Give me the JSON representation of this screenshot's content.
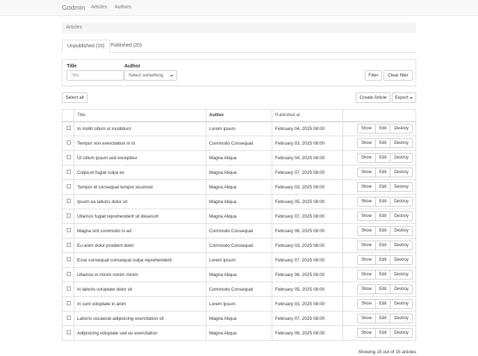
{
  "nav": {
    "brand": "Godmin",
    "links": [
      "Articles",
      "Authors"
    ]
  },
  "breadcrumb": "Articles",
  "tabs": [
    {
      "label": "Unpublished (15)",
      "active": true
    },
    {
      "label": "Published (20)",
      "active": false
    }
  ],
  "filter": {
    "title_label": "Title",
    "title_placeholder": "Title",
    "author_label": "Author",
    "author_select": "Select something",
    "filter_btn": "Filter",
    "clear_btn": "Clear filter"
  },
  "toolbar": {
    "select_all": "Select all",
    "create": "Create Article",
    "export": "Export"
  },
  "table": {
    "headers": [
      "Title",
      "Author",
      "Published at"
    ],
    "actions": [
      "Show",
      "Edit",
      "Destroy"
    ],
    "rows": [
      [
        "In mollit cillum ut incididunt",
        "Lorem Ipsum",
        "February 04, 2025 08:00"
      ],
      [
        "Tempor non exercitation in id",
        "Commodo Consequat",
        "February 03, 2025 08:00"
      ],
      [
        "Ut cillum ipsum sed excepteur",
        "Magna Aliqua",
        "February 04, 2025 08:00"
      ],
      [
        "Culpa et fugiat culpa ex",
        "Magna Aliqua",
        "February 07, 2025 08:00"
      ],
      [
        "Tempor id consequat tempor eiusmod",
        "Magna Aliqua",
        "February 03, 2025 08:00"
      ],
      [
        "Ipsum ea laboris dolor sit",
        "Magna Aliqua",
        "February 05, 2025 08:00"
      ],
      [
        "Ullamco fugiat reprehenderit sit deserunt",
        "Magna Aliqua",
        "February 07, 2025 08:00"
      ],
      [
        "Magna sint commodo in ad",
        "Commodo Consequat",
        "February 08, 2025 08:00"
      ],
      [
        "Eu anim dolor proident dolor",
        "Commodo Consequat",
        "February 03, 2025 08:00"
      ],
      [
        "Esse consequat consequat culpa reprehenderit",
        "Lorem Ipsum",
        "February 07, 2025 08:00"
      ],
      [
        "Ullamco in minim minim minim",
        "Magna Aliqua",
        "February 06, 2025 08:00"
      ],
      [
        "In laboris voluptate dolor sit",
        "Commodo Consequat",
        "February 05, 2025 08:00"
      ],
      [
        "In sunt voluptate in anim",
        "Lorem Ipsum",
        "February 03, 2025 08:00"
      ],
      [
        "Laboris occaecat adipisicing exercitation sit",
        "Magna Aliqua",
        "February 07, 2025 08:00"
      ],
      [
        "Adipisicing voluptate sed eu exercitation",
        "Magna Aliqua",
        "February 06, 2025 08:00"
      ]
    ]
  },
  "footer": "Showing 15 out of 15 articles"
}
